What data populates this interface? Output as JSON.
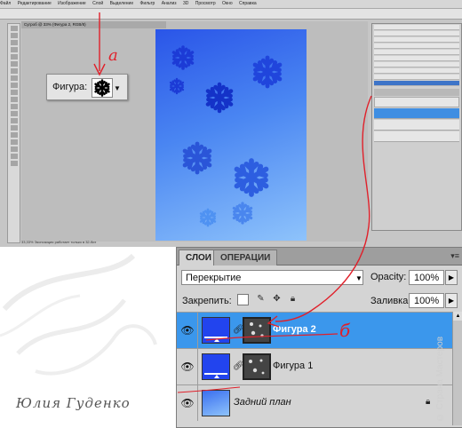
{
  "photoshop": {
    "menu_items": [
      "Файл",
      "Редактирование",
      "Изображение",
      "Слой",
      "Выделение",
      "Фильтр",
      "Анализ",
      "3D",
      "Просмотр",
      "Окно",
      "Справка"
    ],
    "doc_tab": "Сугроб @ 33% (Фигура 2, RGB/8)",
    "status_text": "33,33%   Экспозиция работает только в 32-бит",
    "history_rows": 10,
    "small_layers_rows": 3
  },
  "callout": {
    "label": "Фигура:",
    "annotation_a": "а"
  },
  "annotation_b": "б",
  "layers_panel": {
    "tab_layers": "СЛОИ",
    "tab_operations": "ОПЕРАЦИИ",
    "menu_icon": "panel-menu-icon",
    "blend_mode": "Перекрытие",
    "opacity_label": "Opacity:",
    "opacity_value": "100%",
    "lock_label": "Закрепить:",
    "fill_label": "Заливка:",
    "fill_value": "100%",
    "layers": [
      {
        "name": "Фигура 2",
        "selected": true,
        "type": "shape"
      },
      {
        "name": "Фигура 1",
        "selected": false,
        "type": "shape"
      },
      {
        "name": "Задний план",
        "selected": false,
        "type": "background",
        "locked": true
      }
    ]
  },
  "signature": "Юлия Гуденко",
  "watermark": "© Страна Мастеров",
  "colors": {
    "selected_row": "#3b97ec",
    "shape_fill": "#2244ee",
    "arrow": "#e0202a"
  }
}
